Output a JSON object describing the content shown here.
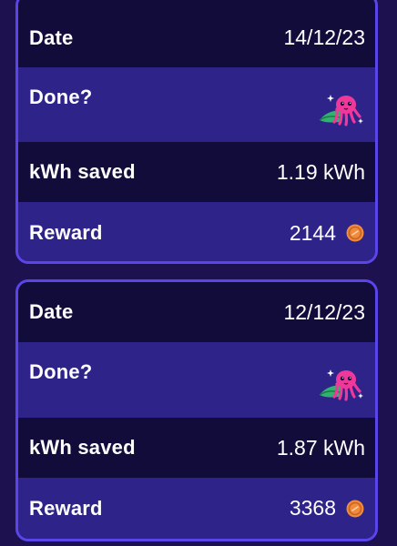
{
  "records": [
    {
      "date_label": "Date",
      "date_value": "14/12/23",
      "done_label": "Done?",
      "done_icon": "octopus-mascot-icon",
      "kwh_label": "kWh saved",
      "kwh_value": "1.19 kWh",
      "reward_label": "Reward",
      "reward_value": "2144",
      "reward_icon": "coin-icon"
    },
    {
      "date_label": "Date",
      "date_value": "12/12/23",
      "done_label": "Done?",
      "done_icon": "octopus-mascot-icon",
      "kwh_label": "kWh saved",
      "kwh_value": "1.87 kWh",
      "reward_label": "Reward",
      "reward_value": "3368",
      "reward_icon": "coin-icon"
    }
  ],
  "colors": {
    "background": "#1d1150",
    "card_border": "#5a45e8",
    "row_dark": "#120c3a",
    "row_light": "#2e2389",
    "mascot_pink": "#f0379a",
    "mascot_cape": "#2fb36e",
    "coin_orange": "#f08a3c"
  }
}
